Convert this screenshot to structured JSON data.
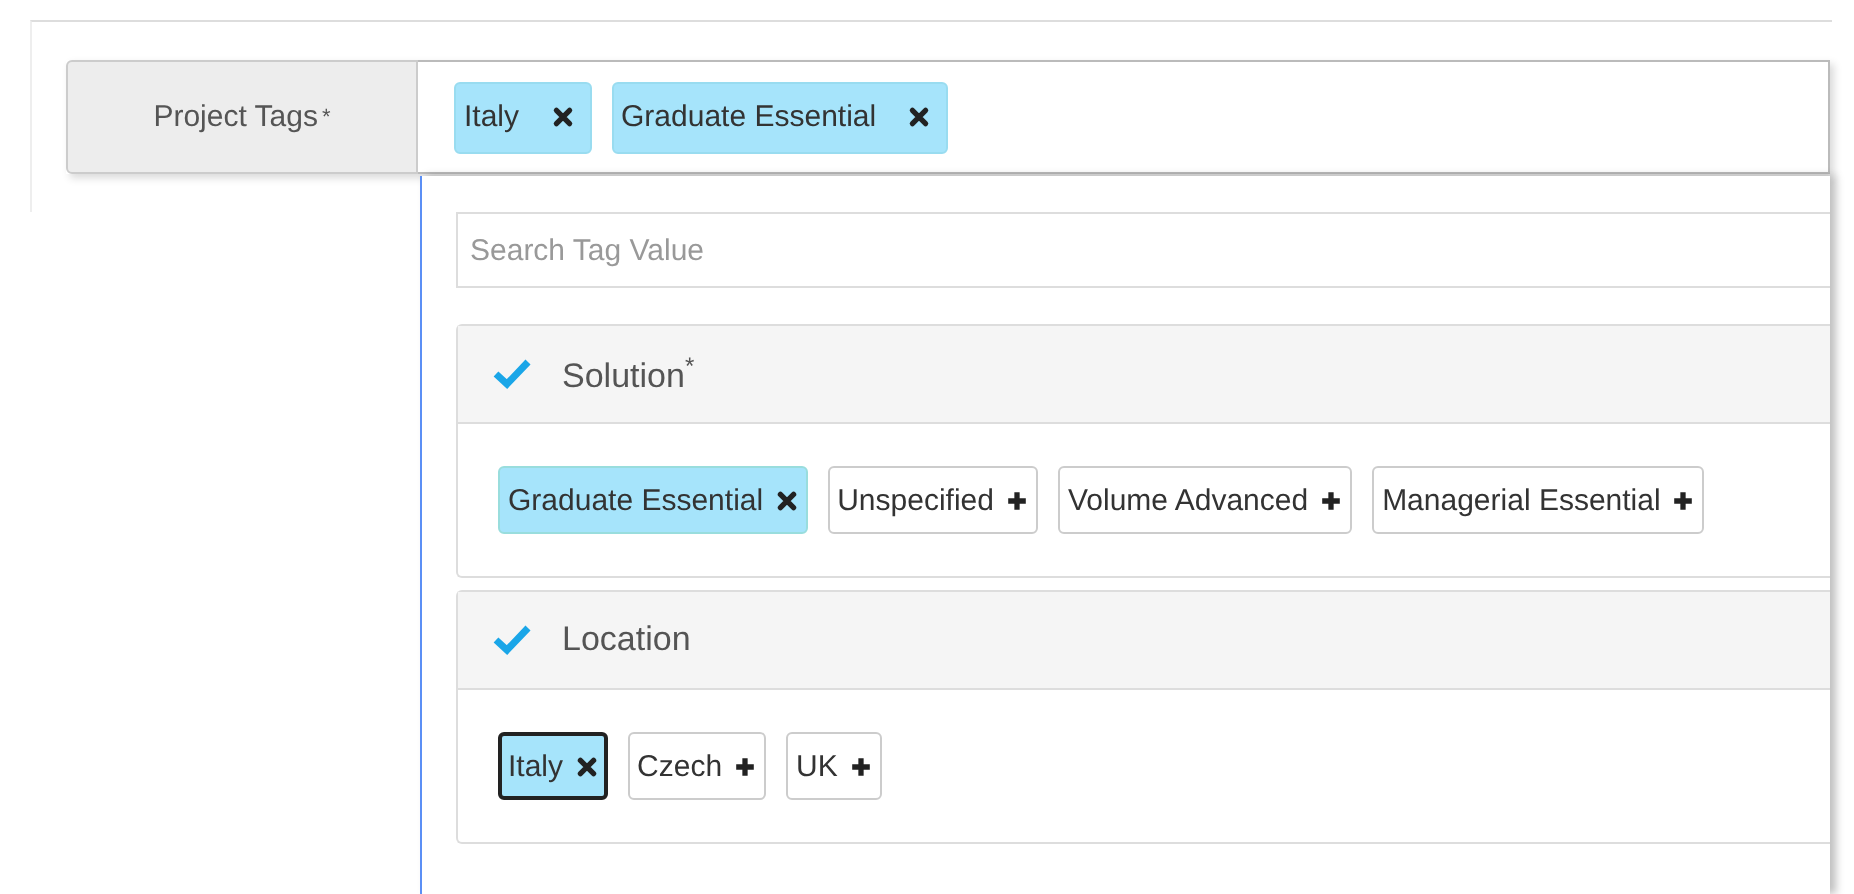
{
  "field": {
    "label": "Project Tags",
    "required_mark": "*",
    "tags": [
      {
        "label": "Italy"
      },
      {
        "label": "Graduate Essential"
      }
    ]
  },
  "dropdown": {
    "search": {
      "placeholder": "Search Tag Value"
    },
    "groups": [
      {
        "title": "Solution",
        "required_mark": "*",
        "checked": true,
        "options": [
          {
            "label": "Graduate Essential",
            "selected": true,
            "focused": false
          },
          {
            "label": "Unspecified",
            "selected": false,
            "focused": false
          },
          {
            "label": "Volume Advanced",
            "selected": false,
            "focused": false
          },
          {
            "label": "Managerial Essential",
            "selected": false,
            "focused": false
          }
        ]
      },
      {
        "title": "Location",
        "checked": true,
        "options": [
          {
            "label": "Italy",
            "selected": true,
            "focused": true
          },
          {
            "label": "Czech",
            "selected": false,
            "focused": false
          },
          {
            "label": "UK",
            "selected": false,
            "focused": false
          }
        ]
      }
    ]
  }
}
